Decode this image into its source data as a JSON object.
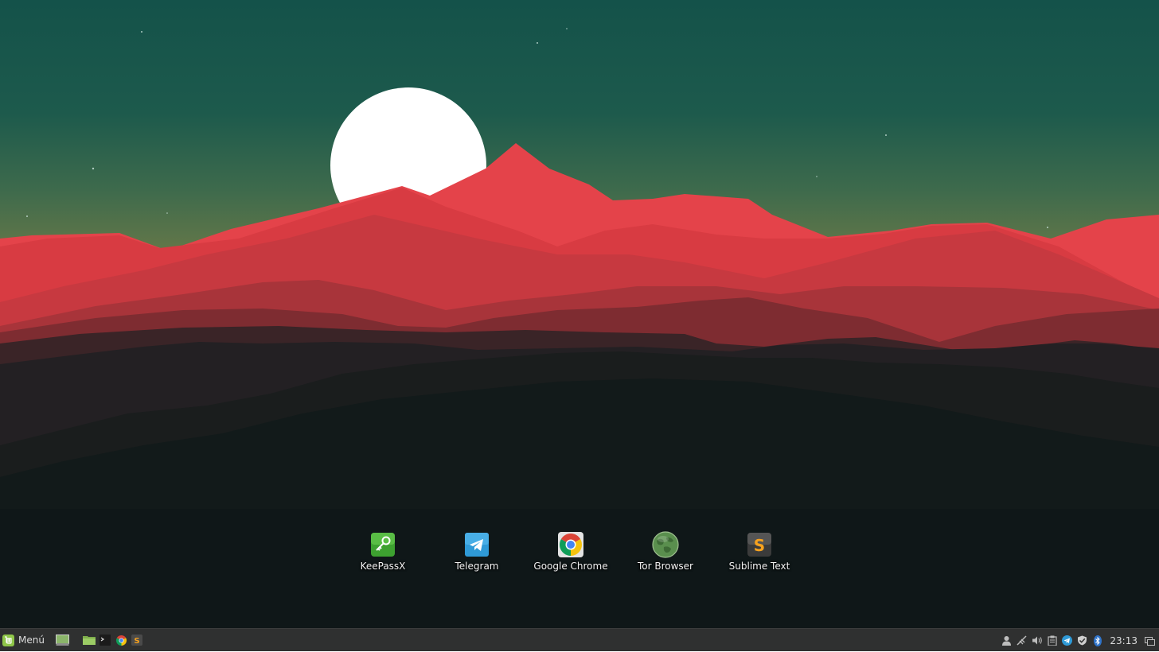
{
  "desktop": {
    "icons": [
      {
        "label": "KeePassX",
        "icon": "keepassx-icon"
      },
      {
        "label": "Telegram",
        "icon": "telegram-icon"
      },
      {
        "label": "Google Chrome",
        "icon": "chrome-icon"
      },
      {
        "label": "Tor Browser",
        "icon": "tor-browser-icon"
      },
      {
        "label": "Sublime Text",
        "icon": "sublime-text-icon"
      }
    ]
  },
  "taskbar": {
    "menu_label": "Menú",
    "launchers": [
      "show-desktop-icon",
      "files-icon",
      "terminal-icon",
      "chrome-icon",
      "sublime-text-icon"
    ],
    "tray": [
      "user-icon",
      "network-icon",
      "volume-icon",
      "clipboard-icon",
      "telegram-icon",
      "shield-icon",
      "bluetooth-icon"
    ],
    "clock": "23:13"
  },
  "colors": {
    "sky_top": "#14524a",
    "sky_horizon": "#6b7a48",
    "mountain_red": "#e4434a",
    "taskbar": "#2f3030"
  }
}
